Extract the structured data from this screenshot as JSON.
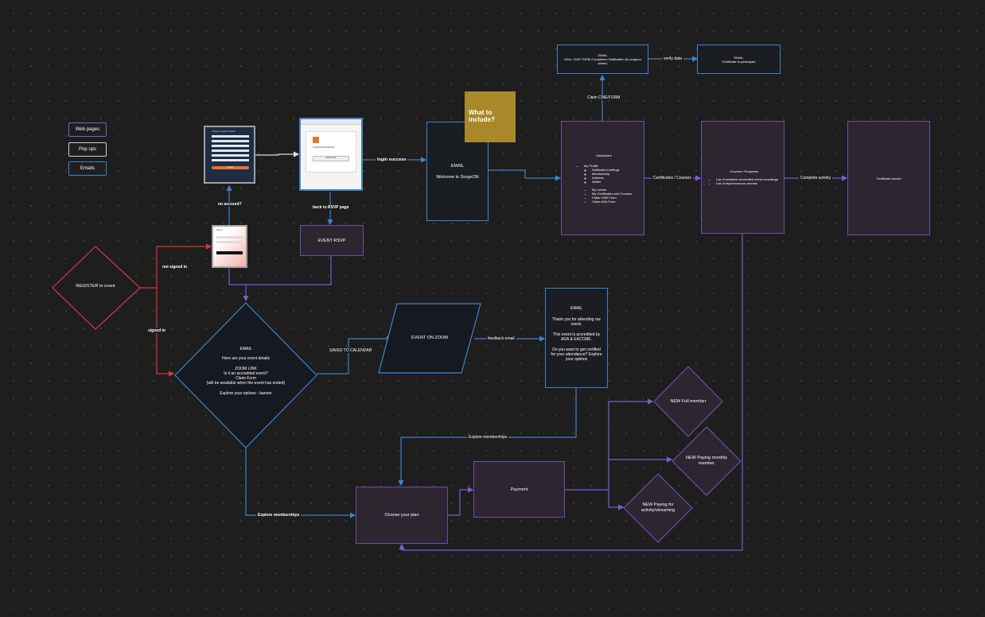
{
  "legend": {
    "web_pages": "Web pages",
    "pop_ups": "Pop ups",
    "emails": "Emails"
  },
  "colors": {
    "webpage_border": "#6b4fa8",
    "email_border": "#3f82c9",
    "register_border": "#d23a3a",
    "sticky": "#a9882a",
    "background": "#1e1e1e"
  },
  "register": {
    "label": "REGISTER to event"
  },
  "edges": {
    "not_signed_in": "not signed in",
    "signed_in": "signed in",
    "no_account": "no account?",
    "back_to_rsvp": "back to RSVP page",
    "login_success": "login success",
    "saved_to_calendar": "SAVED TO CALENDAR",
    "feedback_email": "feedback email",
    "explore_memberships_1": "Explore memberships",
    "explore_memberships_2": "Explore memberships",
    "certificates_courses": "Certificates / Courses",
    "complete_activity": "Complete activity",
    "claim_cme": "Claim CME/FORM",
    "verify_data": "verify data"
  },
  "event_rsvp": {
    "label": "EVENT RSVP"
  },
  "email_welcome": {
    "title": "EMAIL",
    "body": "Welcome to SurgeON"
  },
  "sticky": {
    "text": "What to include?"
  },
  "email_event_details": {
    "title": "EMAIL",
    "line1": "Here are your event details",
    "line2": "ZOOM LINK",
    "line3": "Is it an accredited event?",
    "line4": "Claim Form",
    "line5": "(will be available when the event has ended)",
    "line6": "Explore your options - banner"
  },
  "event_on_zoom": {
    "label": "EVENT ON ZOOM"
  },
  "email_thanks": {
    "title": "EMAIL",
    "p1": "Thank you for attending our event.",
    "p2": "This event is accredited by ADA & EACCME.",
    "p3": "Do you want to get certified for your attendance? Explore your options"
  },
  "choose_plan": {
    "label": "Choose your plan"
  },
  "payment": {
    "label": "Payment"
  },
  "plans": {
    "full_member": "NEW Full member",
    "monthly_member": "NEW Paying monthly member",
    "activity_streaming": "NEW Paying for activity/streaming"
  },
  "dashboard": {
    "title": "Dashboard",
    "my_profile": "My Profile",
    "profile_items": [
      "Notification settings",
      "Membership",
      "Address",
      "Wallet"
    ],
    "other_items": [
      "My events",
      "My Certificates and Courses",
      "Claim CME Form",
      "Claim ADA Form"
    ]
  },
  "courses": {
    "title": "Courses / Programs",
    "items": [
      "List of available accredited event recordings",
      "List of asynchronous courses"
    ]
  },
  "certificate_issued": {
    "label": "Certificate issued"
  },
  "email_ada": {
    "title": "EMAIL",
    "body": "ADA / CME FORM Completion Notification (to surgeon admin)"
  },
  "email_cert": {
    "title": "EMAIL",
    "body": "Certificate to participant"
  },
  "mock_login": {
    "title": "Create a surgeon account",
    "button": "Log in"
  },
  "mock_rsvp": {
    "title": "SurgeON 2024 Webinar",
    "button": "RSVP NOW"
  },
  "mock_popup": {
    "title": "Sign in"
  }
}
